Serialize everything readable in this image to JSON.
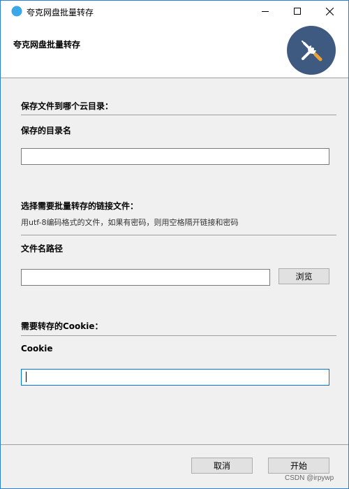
{
  "window": {
    "title": "夸克网盘批量转存",
    "controls": {
      "minimize": "minimize-icon",
      "maximize": "maximize-icon",
      "close": "close-icon"
    }
  },
  "banner": {
    "title": "夸克网盘批量转存",
    "icon": "tools-icon",
    "icon_bg": "#3f5a81"
  },
  "sections": {
    "save_dir": {
      "title": "保存文件到哪个云目录：",
      "label": "保存的目录名",
      "value": ""
    },
    "link_file": {
      "title": "选择需要批量转存的链接文件：",
      "desc": "用utf-8编码格式的文件，如果有密码，则用空格隔开链接和密码",
      "label": "文件名路径",
      "value": "",
      "browse_label": "浏览"
    },
    "cookie": {
      "title": "需要转存的Cookie：",
      "label": "Cookie",
      "value": ""
    }
  },
  "footer": {
    "cancel_label": "取消",
    "start_label": "开始"
  },
  "watermark": "CSDN @irpywp",
  "colors": {
    "accent": "#0078d7",
    "window_border": "#2b7fd6",
    "dialog_bg": "#f0f0f0"
  }
}
